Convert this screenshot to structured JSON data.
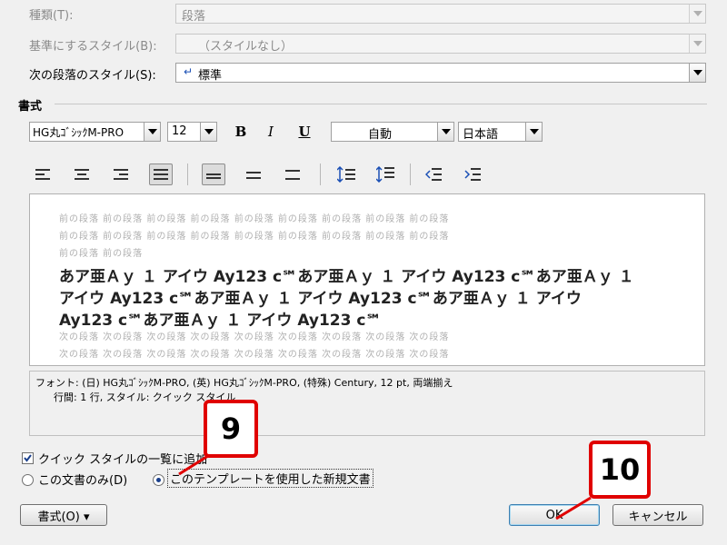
{
  "style_props": {
    "kind_label": "種類(T):",
    "kind_value": "段落",
    "base_label": "基準にするスタイル(B):",
    "base_value": "（スタイルなし）",
    "next_label": "次の段落のスタイル(S):",
    "next_value": "標準"
  },
  "format": {
    "section_label": "書式",
    "font": "HG丸ｺﾞｼｯｸM-PRO",
    "size": "12",
    "bold": "B",
    "italic": "I",
    "underline": "U",
    "color": "自動",
    "language": "日本語"
  },
  "preview": {
    "prev_line1": "前の段落 前の段落 前の段落 前の段落 前の段落 前の段落 前の段落 前の段落 前の段落",
    "prev_line2": "前の段落 前の段落 前の段落 前の段落 前の段落 前の段落 前の段落 前の段落 前の段落",
    "prev_line3": "前の段落 前の段落",
    "sample_line1": "あア亜Ａｙ １ アイウ Ay123 c℠あア亜Ａｙ １ アイウ Ay123 c℠あア亜Ａｙ １",
    "sample_line2": "アイウ Ay123 c℠あア亜Ａｙ １ アイウ Ay123 c℠あア亜Ａｙ １ アイウ",
    "sample_line3": "Ay123 c℠あア亜Ａｙ １ アイウ Ay123 c℠",
    "next_line1": "次の段落 次の段落 次の段落 次の段落 次の段落 次の段落 次の段落 次の段落 次の段落",
    "next_line2": "次の段落 次の段落 次の段落 次の段落 次の段落 次の段落 次の段落 次の段落 次の段落"
  },
  "description": {
    "line1": "フォント: (日) HG丸ｺﾞｼｯｸM-PRO, (英) HG丸ｺﾞｼｯｸM-PRO, (特殊) Century, 12 pt, 両端揃え",
    "line2": "行間:  1 行, スタイル: クイック スタイル"
  },
  "options": {
    "quick_style_label": "クイック スタイルの一覧に追加",
    "quick_style_checked": true,
    "radio_doc_only": "この文書のみ(D)",
    "radio_template": "このテンプレートを使用した新規文書",
    "selected": "template"
  },
  "buttons": {
    "format": "書式(O) ▾",
    "ok": "OK",
    "cancel": "キャンセル"
  },
  "callouts": {
    "step9": "9",
    "step10": "10"
  },
  "colors": {
    "callout_border": "#e00000",
    "dialog_bg": "#f0f0f0"
  }
}
